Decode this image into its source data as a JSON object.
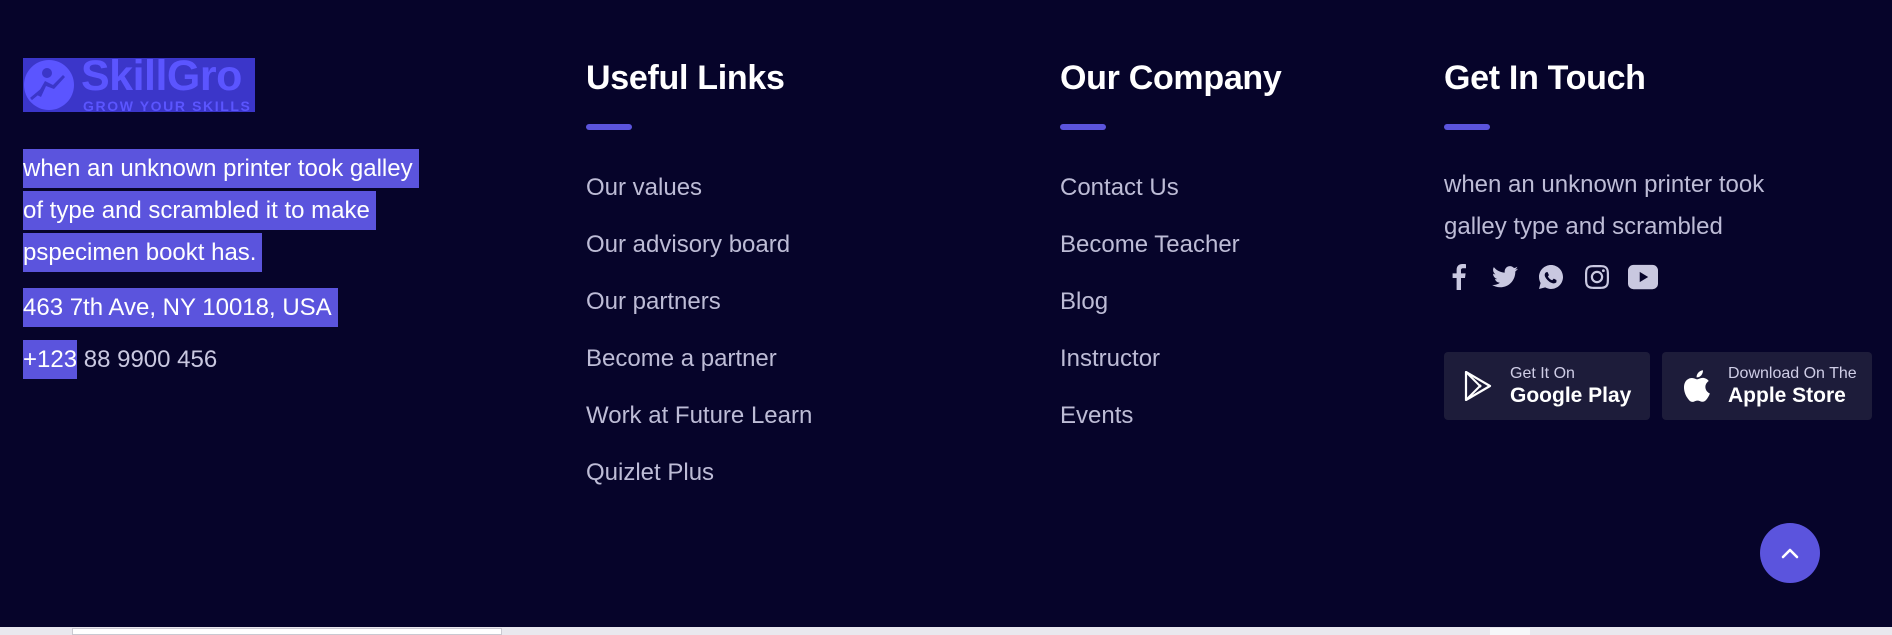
{
  "about": {
    "logo": {
      "name": "SkillGro",
      "tagline": "GROW YOUR SKILLS"
    },
    "description_lines": [
      "when an unknown printer took galley",
      "of type and scrambled it to make",
      "pspecimen bookt has."
    ],
    "address": "463 7th Ave, NY 10018, USA",
    "phone_prefix": "+123",
    "phone_rest": " 88 9900 456"
  },
  "useful_links": {
    "title": "Useful Links",
    "items": [
      "Our values",
      "Our advisory board",
      "Our partners",
      "Become a partner",
      "Work at Future Learn",
      "Quizlet Plus"
    ]
  },
  "our_company": {
    "title": "Our Company",
    "items": [
      "Contact Us",
      "Become Teacher",
      "Blog",
      "Instructor",
      "Events"
    ]
  },
  "get_in_touch": {
    "title": "Get In Touch",
    "text_lines": [
      "when an unknown printer took",
      "galley type and scrambled"
    ],
    "socials": [
      "facebook-icon",
      "twitter-icon",
      "whatsapp-icon",
      "instagram-icon",
      "youtube-icon"
    ],
    "google_play": {
      "line1": "Get It On",
      "line2": "Google Play"
    },
    "apple_store": {
      "line1": "Download On The",
      "line2": "Apple Store"
    }
  },
  "colors": {
    "background": "#06042a",
    "accent": "#5b54dd",
    "text_muted": "#bdbcd6"
  }
}
